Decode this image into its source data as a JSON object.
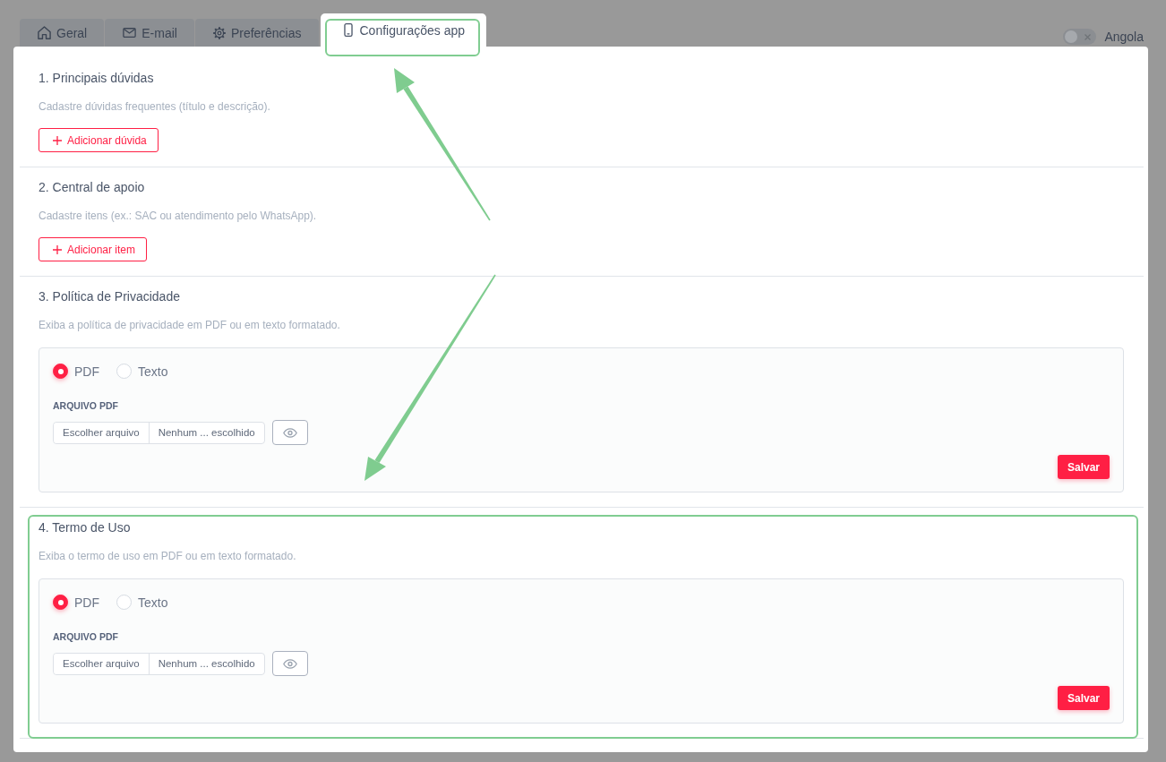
{
  "tabs": [
    {
      "label": "Geral",
      "selected": false,
      "highlighted": false
    },
    {
      "label": "E-mail",
      "selected": false,
      "highlighted": false
    },
    {
      "label": "Preferências",
      "selected": false,
      "highlighted": false
    },
    {
      "label": "Configurações app",
      "selected": true,
      "highlighted": true
    }
  ],
  "country_switch": {
    "label": "Angola",
    "on": false
  },
  "sections": [
    {
      "kind": "list",
      "title": "1. Principais dúvidas",
      "description": "Cadastre dúvidas frequentes (título e descrição).",
      "add_button": "Adicionar dúvida",
      "highlighted": false
    },
    {
      "kind": "list",
      "title": "2. Central de apoio",
      "description": "Cadastre itens (ex.: SAC ou atendimento pelo WhatsApp).",
      "add_button": "Adicionar item",
      "highlighted": false
    },
    {
      "kind": "document",
      "title": "3. Política de Privacidade",
      "description": "Exiba a política de privacidade em PDF ou em texto formatado.",
      "formats": [
        {
          "label": "PDF",
          "selected": true
        },
        {
          "label": "Texto",
          "selected": false
        }
      ],
      "file_label": "ARQUIVO PDF",
      "file_button": "Escolher arquivo",
      "file_status": "Nenhum ... escolhido",
      "save_button": "Salvar",
      "highlighted": false
    },
    {
      "kind": "document",
      "title": "4. Termo de Uso",
      "description": "Exiba o termo de uso em PDF ou em texto formatado.",
      "formats": [
        {
          "label": "PDF",
          "selected": true
        },
        {
          "label": "Texto",
          "selected": false
        }
      ],
      "file_label": "ARQUIVO PDF",
      "file_button": "Escolher arquivo",
      "file_status": "Nenhum ... escolhido",
      "save_button": "Salvar",
      "highlighted": true
    }
  ]
}
